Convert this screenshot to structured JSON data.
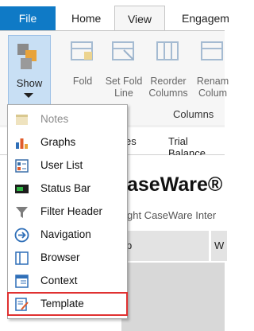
{
  "ribbon": {
    "tabs": {
      "file": "File",
      "home": "Home",
      "view": "View",
      "engagement": "Engagem"
    },
    "show_label": "Show",
    "buttons": [
      {
        "label": "Fold"
      },
      {
        "label": "Set Fold\nLine"
      },
      {
        "label": "Reorder\nColumns"
      },
      {
        "label": "Renam\nColum"
      }
    ],
    "group_label": "Columns"
  },
  "show_menu": {
    "items": [
      {
        "label": "Notes",
        "icon": "notes-icon",
        "enabled": false
      },
      {
        "label": "Graphs",
        "icon": "graphs-icon",
        "enabled": true
      },
      {
        "label": "User List",
        "icon": "user-list-icon",
        "enabled": true
      },
      {
        "label": "Status Bar",
        "icon": "status-bar-icon",
        "enabled": true
      },
      {
        "label": "Filter Header",
        "icon": "filter-icon",
        "enabled": true
      },
      {
        "label": "Navigation",
        "icon": "navigation-icon",
        "enabled": true
      },
      {
        "label": "Browser",
        "icon": "browser-icon",
        "enabled": true
      },
      {
        "label": "Context",
        "icon": "context-icon",
        "enabled": true
      },
      {
        "label": "Template",
        "icon": "template-icon",
        "enabled": true,
        "highlighted": true
      }
    ]
  },
  "document": {
    "tab_fragment": "es",
    "tab_trial_balance": "Trial Balance",
    "brand_title": "aseWare®",
    "copyright": "ght CaseWare Inter",
    "header_cell_1": "p",
    "header_cell_2": "W"
  },
  "colors": {
    "accent": "#0f7ac6",
    "highlight_border": "#e03131",
    "show_pressed": "#c8dff4"
  }
}
